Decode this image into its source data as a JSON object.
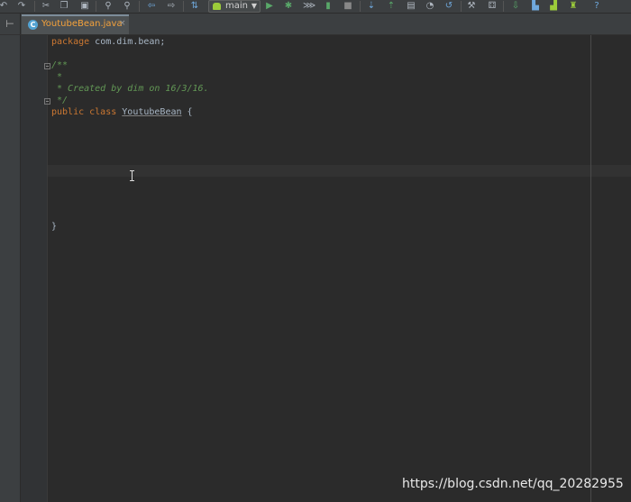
{
  "toolbar": {
    "icons": [
      "undo-icon",
      "redo-icon",
      "cut-icon",
      "copy-icon",
      "paste-icon",
      "find-icon",
      "replace-icon",
      "back-icon",
      "forward-icon",
      "make-project-icon",
      "run-icon",
      "debug-icon",
      "attach-debugger-icon",
      "coverage-icon",
      "stop-icon",
      "vcs-update-icon",
      "vcs-commit-icon",
      "vcs-compare-icon",
      "vcs-history-icon",
      "vcs-revert-icon",
      "project-structure-icon",
      "sdk-manager-icon",
      "avd-manager-icon",
      "gradle-sync-icon",
      "android-monitor-icon",
      "android-device-icon",
      "help-icon"
    ],
    "run_config_label": "main"
  },
  "tabs": [
    {
      "label": "YoutubeBean.java",
      "icon": "class-file-icon",
      "icon_letter": "C",
      "close": "×"
    }
  ],
  "editor": {
    "lines": {
      "package_kw": "package",
      "package_name": " com.dim.bean;",
      "comment_open": "/**",
      "comment_star": " *",
      "comment_created": " * Created by dim on 16/3/16.",
      "comment_close": " */",
      "class_kw": "public class ",
      "class_name": "YoutubeBean",
      "class_brace": " {",
      "closing_brace": "}"
    }
  },
  "watermark": "https://blog.csdn.net/qq_20282955",
  "colors": {
    "background": "#2b2b2b",
    "keyword": "#cc7832",
    "comment": "#629755",
    "text": "#a9b7c6",
    "tab_label": "#f5a23b"
  }
}
